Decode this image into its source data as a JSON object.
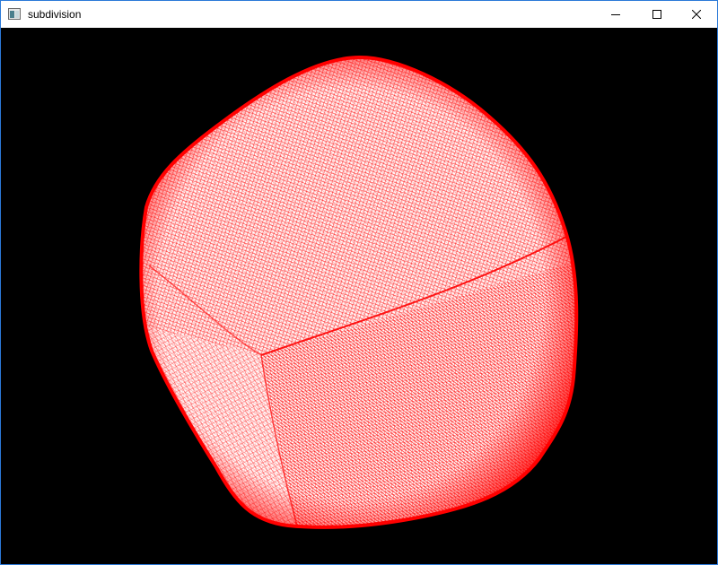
{
  "window": {
    "title": "subdivision",
    "controls": {
      "minimize_icon": "minimize-icon",
      "maximize_icon": "maximize-icon",
      "close_icon": "close-icon"
    }
  },
  "viewport": {
    "background_color": "#000000",
    "mesh": {
      "render_mode": "wireframe",
      "wire_color": "#ff0000",
      "fill_color": "#ffffff",
      "shape": "subdivided cube"
    }
  },
  "colors": {
    "accent_border": "#2b79d8",
    "titlebar_bg": "#ffffff"
  }
}
